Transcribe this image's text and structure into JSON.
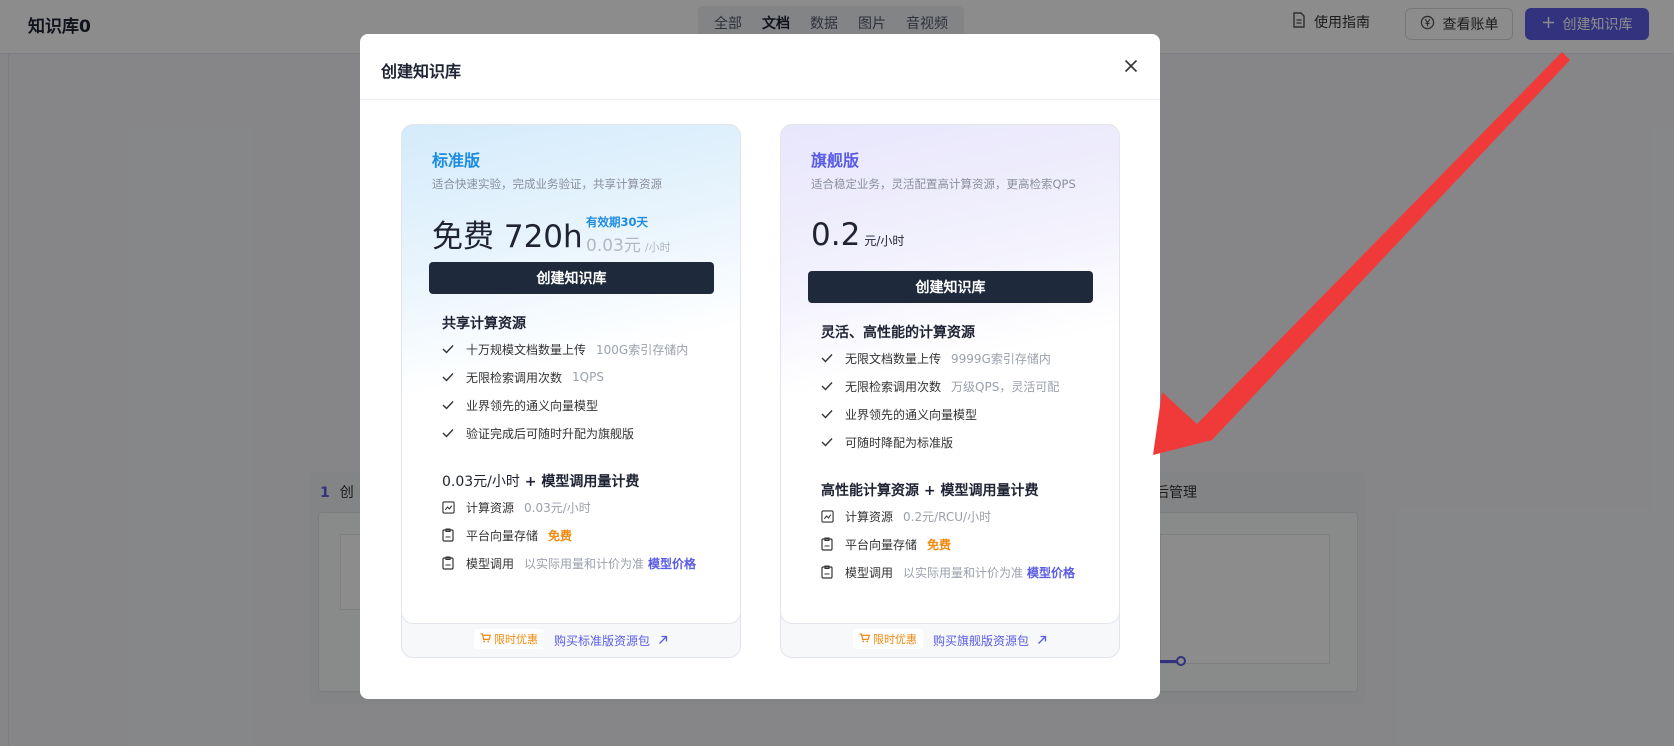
{
  "app": {
    "title": "知识库0"
  },
  "filter_tabs": [
    {
      "label": "全部",
      "active": false
    },
    {
      "label": "文档",
      "active": true
    },
    {
      "label": "数据",
      "active": false
    },
    {
      "label": "图片",
      "active": false
    },
    {
      "label": "音视频",
      "active": false
    }
  ],
  "header_actions": {
    "guide": "使用指南",
    "bill": "查看账单",
    "create": "创建知识库"
  },
  "background": {
    "step1_num": "1",
    "step1_label": "创",
    "step3_label": "后管理"
  },
  "modal": {
    "title": "创建知识库",
    "plans": {
      "standard": {
        "name": "标准版",
        "desc": "适合快速实验，完成业务验证，共享计算资源",
        "price_main": "免费 720h",
        "price_valid": "有效期30天",
        "price_old": "0.03元",
        "price_old_unit": "/小时",
        "button": "创建知识库",
        "section1": "共享计算资源",
        "features": [
          {
            "text": "十万规模文档数量上传",
            "note": "100G索引存储内"
          },
          {
            "text": "无限检索调用次数",
            "note": "1QPS"
          },
          {
            "text": "业界领先的通义向量模型",
            "note": ""
          },
          {
            "text": "验证完成后可随时升配为旗舰版",
            "note": ""
          }
        ],
        "billing_title_price": "0.03元/小时",
        "billing_title_rest": " + 模型调用量计费",
        "billing": [
          {
            "label": "计算资源",
            "note": "0.03元/小时"
          },
          {
            "label": "平台向量存储",
            "free": "免费"
          },
          {
            "label": "模型调用",
            "note": "以实际用量和计价为准",
            "link": "模型价格"
          }
        ],
        "promo": "限时优惠",
        "buy": "购买标准版资源包"
      },
      "pro": {
        "name": "旗舰版",
        "desc": "适合稳定业务，灵活配置高计算资源，更高检索QPS",
        "price_num": "0.2",
        "price_unit": "元/小时",
        "button": "创建知识库",
        "section1": "灵活、高性能的计算资源",
        "features": [
          {
            "text": "无限文档数量上传",
            "note": "9999G索引存储内"
          },
          {
            "text": "无限检索调用次数",
            "note": "万级QPS，灵活可配"
          },
          {
            "text": "业界领先的通义向量模型",
            "note": ""
          },
          {
            "text": "可随时降配为标准版",
            "note": ""
          }
        ],
        "billing_title": "高性能计算资源 + 模型调用量计费",
        "billing": [
          {
            "label": "计算资源",
            "note": "0.2元/RCU/小时"
          },
          {
            "label": "平台向量存储",
            "free": "免费"
          },
          {
            "label": "模型调用",
            "note": "以实际用量和计价为准",
            "link": "模型价格"
          }
        ],
        "promo": "限时优惠",
        "buy": "购买旗舰版资源包"
      }
    }
  },
  "colors": {
    "accent": "#5b5ce6",
    "standard_blue": "#1d8ce0",
    "dark_button": "#1e2a3b",
    "free_orange": "#f08a10",
    "annotation_red": "#f03a3a"
  }
}
